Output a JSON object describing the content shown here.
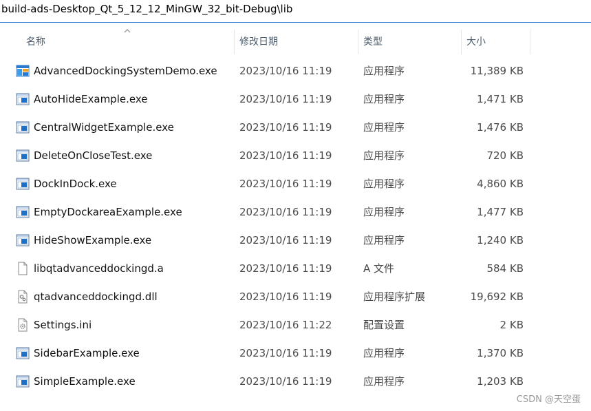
{
  "path": "build-ads-Desktop_Qt_5_12_12_MinGW_32_bit-Debug\\lib",
  "columns": {
    "name": "名称",
    "date": "修改日期",
    "type": "类型",
    "size": "大小"
  },
  "files": [
    {
      "name": "AdvancedDockingSystemDemo.exe",
      "date": "2023/10/16 11:19",
      "type": "应用程序",
      "size": "11,389 KB",
      "icon": "app-logo-icon"
    },
    {
      "name": "AutoHideExample.exe",
      "date": "2023/10/16 11:19",
      "type": "应用程序",
      "size": "1,471 KB",
      "icon": "exe-icon"
    },
    {
      "name": "CentralWidgetExample.exe",
      "date": "2023/10/16 11:19",
      "type": "应用程序",
      "size": "1,476 KB",
      "icon": "exe-icon"
    },
    {
      "name": "DeleteOnCloseTest.exe",
      "date": "2023/10/16 11:19",
      "type": "应用程序",
      "size": "720 KB",
      "icon": "exe-icon"
    },
    {
      "name": "DockInDock.exe",
      "date": "2023/10/16 11:19",
      "type": "应用程序",
      "size": "4,860 KB",
      "icon": "exe-icon"
    },
    {
      "name": "EmptyDockareaExample.exe",
      "date": "2023/10/16 11:19",
      "type": "应用程序",
      "size": "1,477 KB",
      "icon": "exe-icon"
    },
    {
      "name": "HideShowExample.exe",
      "date": "2023/10/16 11:19",
      "type": "应用程序",
      "size": "1,240 KB",
      "icon": "exe-icon"
    },
    {
      "name": "libqtadvanceddockingd.a",
      "date": "2023/10/16 11:19",
      "type": "A 文件",
      "size": "584 KB",
      "icon": "blank-file-icon"
    },
    {
      "name": "qtadvanceddockingd.dll",
      "date": "2023/10/16 11:19",
      "type": "应用程序扩展",
      "size": "19,692 KB",
      "icon": "dll-file-icon"
    },
    {
      "name": "Settings.ini",
      "date": "2023/10/16 11:22",
      "type": "配置设置",
      "size": "2 KB",
      "icon": "ini-file-icon"
    },
    {
      "name": "SidebarExample.exe",
      "date": "2023/10/16 11:19",
      "type": "应用程序",
      "size": "1,370 KB",
      "icon": "exe-icon"
    },
    {
      "name": "SimpleExample.exe",
      "date": "2023/10/16 11:19",
      "type": "应用程序",
      "size": "1,203 KB",
      "icon": "exe-icon"
    }
  ],
  "watermark": "CSDN @天空蛋",
  "colors": {
    "accent": "#2f7cc8",
    "exe_blue": "#1e6fc8"
  }
}
